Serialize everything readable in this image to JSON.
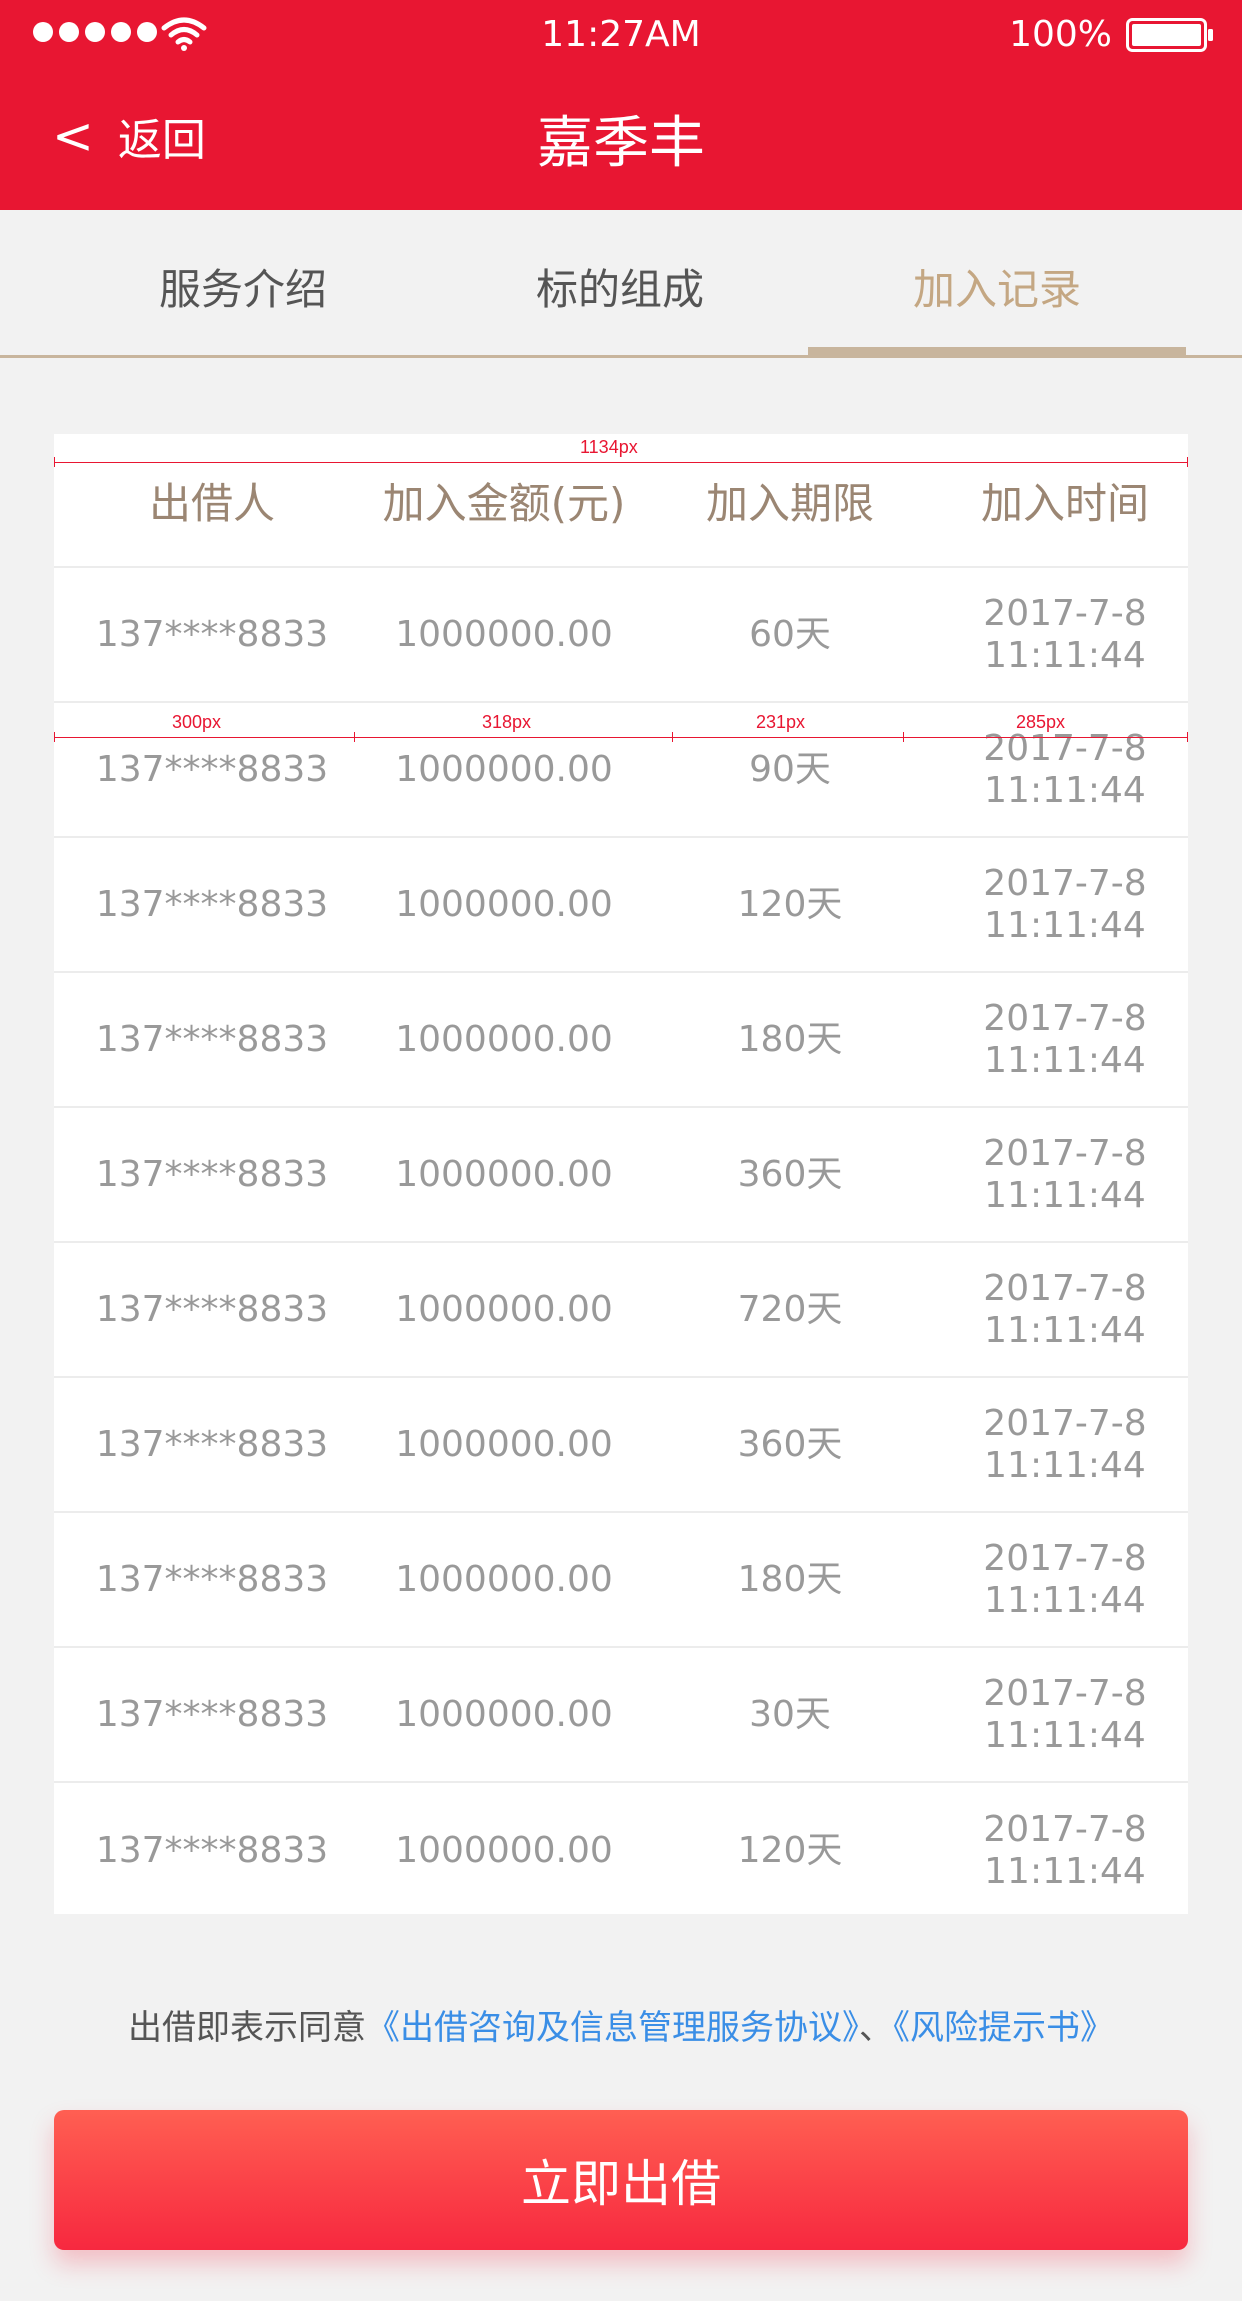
{
  "status_bar": {
    "time": "11:27AM",
    "battery": "100%"
  },
  "nav": {
    "back_label": "返回",
    "title": "嘉季丰"
  },
  "tabs": [
    {
      "label": "服务介绍",
      "active": false
    },
    {
      "label": "标的组成",
      "active": false
    },
    {
      "label": "加入记录",
      "active": true
    }
  ],
  "table": {
    "headers": [
      "出借人",
      "加入金额(元)",
      "加入期限",
      "加入时间"
    ],
    "rows": [
      {
        "lender": "137****8833",
        "amount": "1000000.00",
        "term": "60天",
        "date": "2017-7-8",
        "time": "11:11:44"
      },
      {
        "lender": "137****8833",
        "amount": "1000000.00",
        "term": "90天",
        "date": "2017-7-8",
        "time": "11:11:44"
      },
      {
        "lender": "137****8833",
        "amount": "1000000.00",
        "term": "120天",
        "date": "2017-7-8",
        "time": "11:11:44"
      },
      {
        "lender": "137****8833",
        "amount": "1000000.00",
        "term": "180天",
        "date": "2017-7-8",
        "time": "11:11:44"
      },
      {
        "lender": "137****8833",
        "amount": "1000000.00",
        "term": "360天",
        "date": "2017-7-8",
        "time": "11:11:44"
      },
      {
        "lender": "137****8833",
        "amount": "1000000.00",
        "term": "720天",
        "date": "2017-7-8",
        "time": "11:11:44"
      },
      {
        "lender": "137****8833",
        "amount": "1000000.00",
        "term": "360天",
        "date": "2017-7-8",
        "time": "11:11:44"
      },
      {
        "lender": "137****8833",
        "amount": "1000000.00",
        "term": "180天",
        "date": "2017-7-8",
        "time": "11:11:44"
      },
      {
        "lender": "137****8833",
        "amount": "1000000.00",
        "term": "30天",
        "date": "2017-7-8",
        "time": "11:11:44"
      },
      {
        "lender": "137****8833",
        "amount": "1000000.00",
        "term": "120天",
        "date": "2017-7-8",
        "time": "11:11:44"
      }
    ]
  },
  "annotations": {
    "total": "1134px",
    "col1": "300px",
    "col2": "318px",
    "col3": "231px",
    "col4": "285px"
  },
  "agreement": {
    "prefix": "出借即表示同意",
    "link1": "《出借咨询及信息管理服务协议》",
    "separator": "、",
    "link2": "《风险提示书》"
  },
  "cta": {
    "label": "立即出借"
  },
  "colors": {
    "header_bg": "#e81632",
    "active_tab": "#c4a783",
    "link": "#3a8ee6",
    "button": "#f7283f"
  }
}
